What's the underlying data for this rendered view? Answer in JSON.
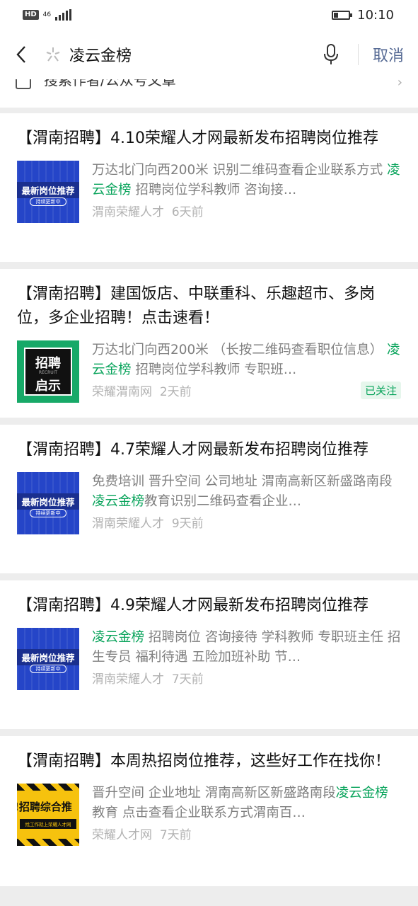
{
  "status": {
    "network": "HD",
    "net_type": "46",
    "time": "10:10"
  },
  "search": {
    "query": "凌云金榜",
    "cancel": "取消"
  },
  "partial_row": {
    "text": "搜索作者/公众号文章"
  },
  "results": [
    {
      "title": "【渭南招聘】4.10荣耀人才网最新发布招聘岗位推荐",
      "desc_before": "万达北门向西200米 识别二维码查看企业联系方式 ",
      "desc_highlight": "凌云金榜",
      "desc_after": " 招聘岗位学科教师 咨询接…",
      "source": "渭南荣耀人才",
      "time": "6天前",
      "thumb": {
        "type": "blue",
        "line1": "最新岗位推荐",
        "line2": "持续更新中"
      },
      "badge": ""
    },
    {
      "title": "【渭南招聘】建国饭店、中联重科、乐趣超市、多岗位，多企业招聘！点击速看！",
      "desc_before": "万达北门向西200米 （长按二维码查看职位信息） ",
      "desc_highlight": "凌云金榜",
      "desc_after": " 招聘岗位学科教师 专职班…",
      "source": "荣耀渭南网",
      "time": "2天前",
      "thumb": {
        "type": "green",
        "line1": "招聘",
        "line2": "RECRUIT",
        "line3": "启示"
      },
      "badge": "已关注"
    },
    {
      "title": "【渭南招聘】4.7荣耀人才网最新发布招聘岗位推荐",
      "desc_before": "免费培训 晋升空间 公司地址 渭南高新区新盛路南段",
      "desc_highlight": "凌云金榜",
      "desc_after": "教育识别二维码查看企业…",
      "source": "渭南荣耀人才",
      "time": "9天前",
      "thumb": {
        "type": "blue",
        "line1": "最新岗位推荐",
        "line2": "持续更新中"
      },
      "badge": ""
    },
    {
      "title": "【渭南招聘】4.9荣耀人才网最新发布招聘岗位推荐",
      "desc_before": "",
      "desc_highlight": "凌云金榜",
      "desc_after": " 招聘岗位 咨询接待 学科教师 专职班主任 招生专员 福利待遇 五险加班补助 节…",
      "source": "渭南荣耀人才",
      "time": "7天前",
      "thumb": {
        "type": "blue",
        "line1": "最新岗位推荐",
        "line2": "持续更新中"
      },
      "badge": ""
    },
    {
      "title": "【渭南招聘】本周热招岗位推荐，这些好工作在找你！",
      "desc_before": "晋升空间 企业地址 渭南高新区新盛路南段",
      "desc_highlight": "凌云金榜",
      "desc_after": "教育 点击查看企业联系方式渭南百…",
      "source": "荣耀人才网",
      "time": "7天前",
      "thumb": {
        "type": "yellow",
        "line1": "!招聘综合推",
        "line2": "找工作就上荣耀人才网"
      },
      "badge": ""
    }
  ]
}
